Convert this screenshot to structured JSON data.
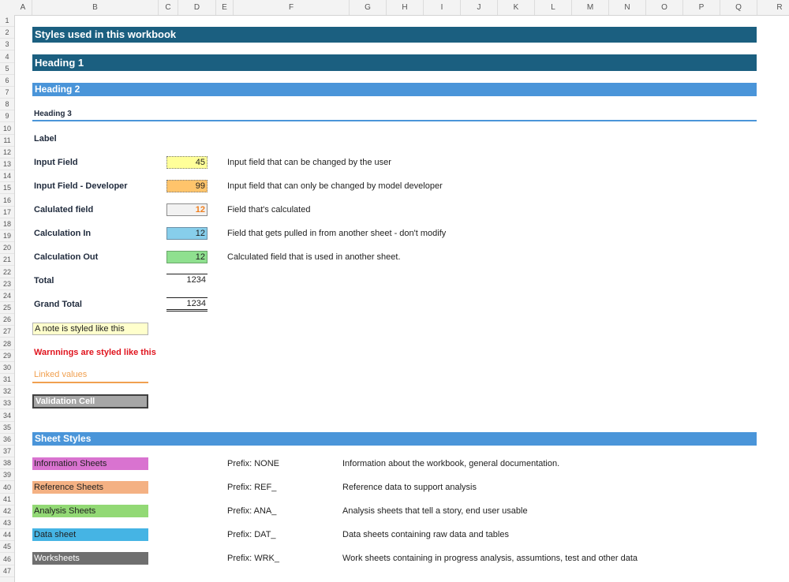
{
  "columns": [
    "A",
    "B",
    "C",
    "D",
    "E",
    "F",
    "G",
    "H",
    "I",
    "J",
    "K",
    "L",
    "M",
    "N",
    "O",
    "P",
    "Q",
    "R"
  ],
  "rows": [
    "1",
    "2",
    "3",
    "4",
    "5",
    "6",
    "7",
    "8",
    "9",
    "10",
    "11",
    "12",
    "13",
    "14",
    "15",
    "16",
    "17",
    "18",
    "19",
    "20",
    "21",
    "22",
    "23",
    "24",
    "25",
    "26",
    "27",
    "28",
    "29",
    "30",
    "31",
    "32",
    "33",
    "34",
    "35",
    "36",
    "37",
    "38",
    "39",
    "40",
    "41",
    "42",
    "43",
    "44",
    "45",
    "46",
    "47"
  ],
  "title": "Styles used in this workbook",
  "heading1": "Heading 1",
  "heading2": "Heading 2",
  "heading3": "Heading 3",
  "label": "Label",
  "fields": [
    {
      "label": "Input Field",
      "value": "45",
      "desc": "Input field that can be changed by the user"
    },
    {
      "label": "Input Field - Developer",
      "value": "99",
      "desc": "Input field that can only be changed by model developer"
    },
    {
      "label": "Calulated field",
      "value": "12",
      "desc": "Field that's calculated"
    },
    {
      "label": "Calculation In",
      "value": "12",
      "desc": "Field that gets pulled in from another sheet - don't modify"
    },
    {
      "label": "Calculation Out",
      "value": "12",
      "desc": "Calculated field that is used in another sheet."
    }
  ],
  "total": {
    "label": "Total",
    "value": "1234"
  },
  "grand_total": {
    "label": "Grand Total",
    "value": "1234"
  },
  "note": "A note is styled like this",
  "warning": "Warnnings are styled like this",
  "linked": "Linked values",
  "validation": "Validation Cell",
  "sheet_styles_title": "Sheet Styles",
  "sheets": [
    {
      "name": "Information Sheets",
      "prefix": "Prefix: NONE",
      "desc": "Information about the workbook, general documentation.",
      "color": "#d973d0"
    },
    {
      "name": "Reference Sheets",
      "prefix": "Prefix: REF_",
      "desc": "Reference data to support analysis",
      "color": "#f4b183"
    },
    {
      "name": "Analysis Sheets",
      "prefix": "Prefix: ANA_",
      "desc": "Analysis sheets that tell a story, end user usable",
      "color": "#92d975"
    },
    {
      "name": "Data sheet",
      "prefix": "Prefix: DAT_",
      "desc": "Data sheets containing raw data  and tables",
      "color": "#45b4e4"
    },
    {
      "name": "Worksheets",
      "prefix": "Prefix: WRK_",
      "desc": "Work sheets containing in progress analysis, assumtions, test and other data",
      "color": "#6f6f6f"
    }
  ],
  "colors": {
    "banner_dark": "#1b5f80",
    "banner_light": "#4a95d9",
    "input": "#ffff99",
    "input_dev": "#ffc46b",
    "calc_in": "#87ceeb",
    "calc_out": "#8fe08f",
    "warning": "#e0141e",
    "linked": "#f0a050",
    "validation": "#a6a6a6"
  }
}
